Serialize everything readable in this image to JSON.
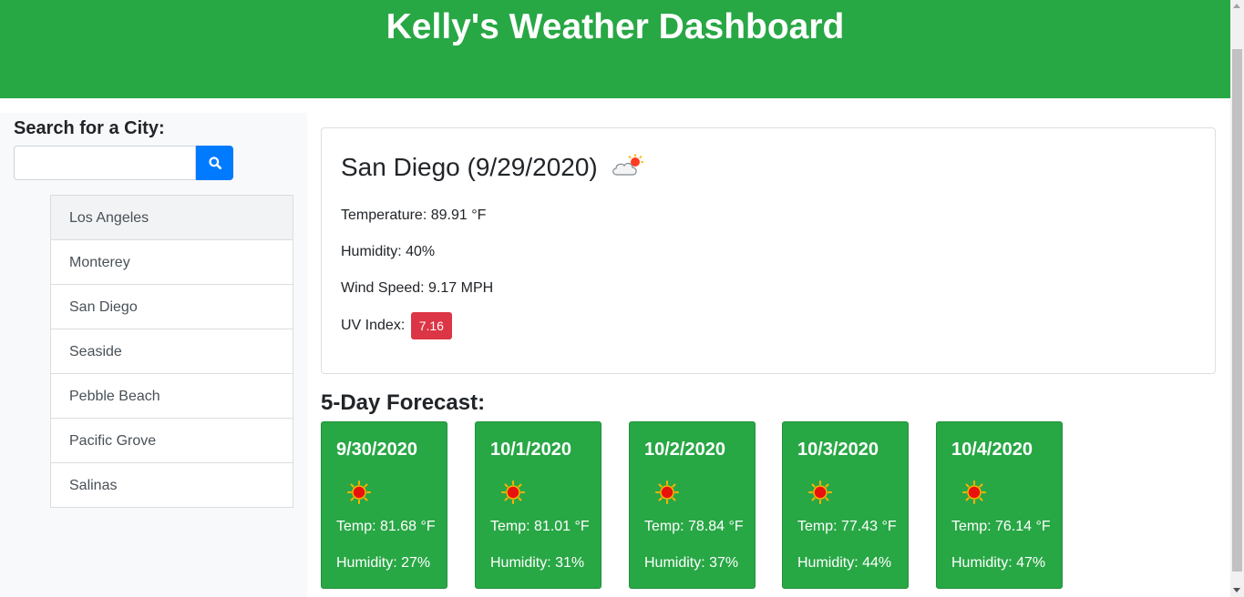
{
  "header": {
    "title": "Kelly's Weather Dashboard",
    "background_color": "#28a745"
  },
  "search": {
    "label": "Search for a City:",
    "value": "",
    "placeholder": "",
    "button_icon": "search-icon",
    "button_color": "#007bff"
  },
  "history": {
    "cities": [
      "Los Angeles",
      "Monterey",
      "San Diego",
      "Seaside",
      "Pebble Beach",
      "Pacific Grove",
      "Salinas"
    ]
  },
  "current": {
    "heading": "San Diego (9/29/2020)",
    "icon": "partly-cloudy-icon",
    "temperature": "Temperature: 89.91 °F",
    "humidity": "Humidity: 40%",
    "wind": "Wind Speed: 9.17 MPH",
    "uv_label": "UV Index:",
    "uv_value": "7.16",
    "uv_color": "#dc3545"
  },
  "forecast": {
    "title": "5-Day Forecast:",
    "card_color": "#28a745",
    "days": [
      {
        "date": "9/30/2020",
        "icon": "sun-icon",
        "temp": "Temp: 81.68 °F",
        "humidity": "Humidity: 27%"
      },
      {
        "date": "10/1/2020",
        "icon": "sun-icon",
        "temp": "Temp: 81.01 °F",
        "humidity": "Humidity: 31%"
      },
      {
        "date": "10/2/2020",
        "icon": "sun-icon",
        "temp": "Temp: 78.84 °F",
        "humidity": "Humidity: 37%"
      },
      {
        "date": "10/3/2020",
        "icon": "sun-icon",
        "temp": "Temp: 77.43 °F",
        "humidity": "Humidity: 44%"
      },
      {
        "date": "10/4/2020",
        "icon": "sun-icon",
        "temp": "Temp: 76.14 °F",
        "humidity": "Humidity: 47%"
      }
    ]
  }
}
